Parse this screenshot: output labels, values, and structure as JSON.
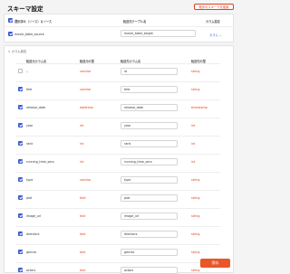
{
  "header": {
    "title": "スキーマ設定",
    "copy_button": "既存のスキーマを複製"
  },
  "table_card": {
    "col_source": "選択済み（ソース）＆ソース",
    "col_target": "転送先テーブル名",
    "col_setting": "カラム設定",
    "source_value": "movie_table_source",
    "target_value": "movie_table_target",
    "setting_link": "カラム"
  },
  "columns_card": {
    "section_label": "カラム設定",
    "headers": {
      "source_col": "転送元カラム名",
      "source_type": "転送元の型",
      "target_col": "転送先カラム名",
      "target_type": "転送先の型"
    },
    "rows": [
      {
        "checked": false,
        "source": "--",
        "type": "varchar",
        "target": "id",
        "target_type": "string"
      },
      {
        "checked": true,
        "source": "title",
        "type": "varchar",
        "target": "title",
        "target_type": "string"
      },
      {
        "checked": true,
        "source": "release_date",
        "type": "datetime",
        "target": "release_date",
        "target_type": "timestamp"
      },
      {
        "checked": true,
        "source": "year",
        "type": "int",
        "target": "year",
        "target_type": "int"
      },
      {
        "checked": true,
        "source": "rank",
        "type": "int",
        "target": "rank",
        "target_type": "int"
      },
      {
        "checked": true,
        "source": "running_time_secs",
        "type": "int",
        "target": "running_time_secs",
        "target_type": "int"
      },
      {
        "checked": true,
        "source": "type",
        "type": "varchar",
        "target": "type",
        "target_type": "string"
      },
      {
        "checked": true,
        "source": "plot",
        "type": "text",
        "target": "plot",
        "target_type": "string"
      },
      {
        "checked": true,
        "source": "image_url",
        "type": "text",
        "target": "image_url",
        "target_type": "string"
      },
      {
        "checked": true,
        "source": "directors",
        "type": "text",
        "target": "directors",
        "target_type": "string"
      },
      {
        "checked": true,
        "source": "genres",
        "type": "text",
        "target": "genres",
        "target_type": "string"
      },
      {
        "checked": true,
        "source": "actors",
        "type": "text",
        "target": "actors",
        "target_type": "string"
      }
    ]
  },
  "footer": {
    "save_label": "保存"
  }
}
